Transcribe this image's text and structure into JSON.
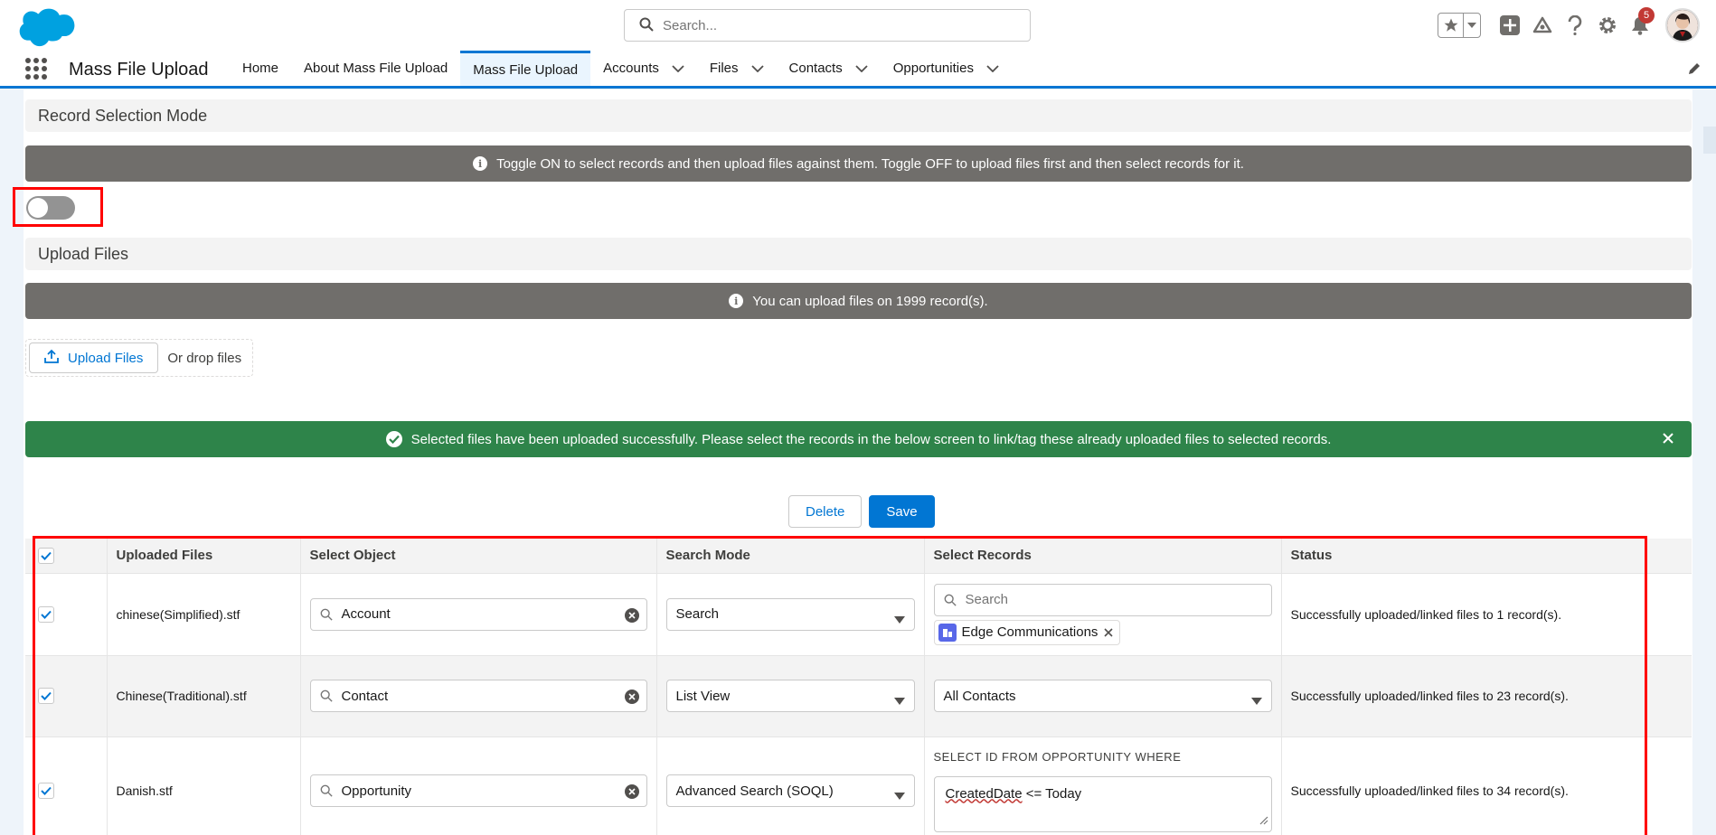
{
  "header": {
    "search_placeholder": "Search...",
    "notification_count": "5",
    "icons": [
      "favorites-star-icon",
      "add-icon",
      "trailhead-icon",
      "help-icon",
      "setup-gear-icon",
      "bell-icon"
    ]
  },
  "app": {
    "name": "Mass File Upload",
    "nav": [
      {
        "label": "Home",
        "active": false,
        "menu": false
      },
      {
        "label": "About Mass File Upload",
        "active": false,
        "menu": false
      },
      {
        "label": "Mass File Upload",
        "active": true,
        "menu": false
      },
      {
        "label": "Accounts",
        "active": false,
        "menu": true
      },
      {
        "label": "Files",
        "active": false,
        "menu": true
      },
      {
        "label": "Contacts",
        "active": false,
        "menu": true
      },
      {
        "label": "Opportunities",
        "active": false,
        "menu": true
      }
    ]
  },
  "record_selection": {
    "title": "Record Selection Mode",
    "info": "Toggle ON to select records and then upload files against them. Toggle OFF to upload files first and then select records for it.",
    "toggle_on": false
  },
  "upload": {
    "title": "Upload Files",
    "info": "You can upload files on 1999 record(s).",
    "button_label": "Upload Files",
    "drop_text": "Or drop files"
  },
  "success_message": "Selected files have been uploaded successfully. Please select the records in the below screen to link/tag these already uploaded files to selected records.",
  "actions": {
    "delete_label": "Delete",
    "save_label": "Save"
  },
  "table": {
    "columns": [
      "Uploaded Files",
      "Select Object",
      "Search Mode",
      "Select Records",
      "Status"
    ],
    "rows": [
      {
        "checked": true,
        "file": "chinese(Simplified).stf",
        "object": "Account",
        "mode": "Search",
        "records_placeholder": "Search",
        "selected_pill": "Edge Communications",
        "status": "Successfully uploaded/linked files to 1 record(s)."
      },
      {
        "checked": true,
        "file": "Chinese(Traditional).stf",
        "object": "Contact",
        "mode": "List View",
        "records_value": "All Contacts",
        "status": "Successfully uploaded/linked files to 23 record(s)."
      },
      {
        "checked": true,
        "file": "Danish.stf",
        "object": "Opportunity",
        "mode": "Advanced Search (SOQL)",
        "soql_prefix": "SELECT ID FROM OPPORTUNITY WHERE",
        "soql_keyword": "CreatedDate",
        "soql_rest": " <= Today",
        "status": "Successfully uploaded/linked files to 34 record(s)."
      }
    ]
  },
  "colors": {
    "brand": "#0176d3",
    "success": "#2e844a",
    "info": "#706e6b",
    "highlight": "#ff0000"
  }
}
